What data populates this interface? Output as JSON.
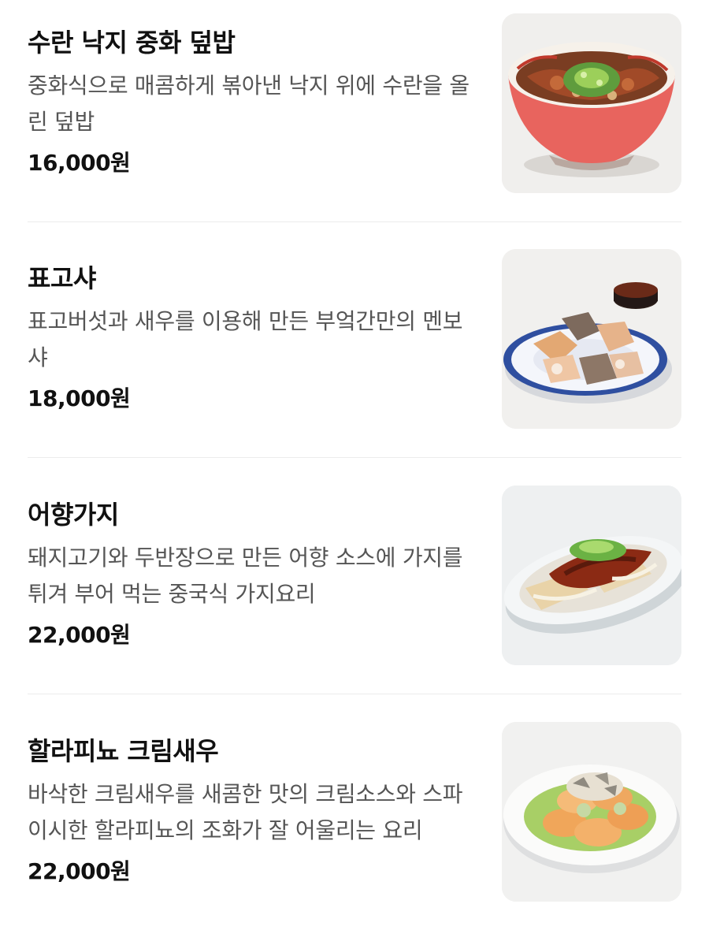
{
  "menu": {
    "items": [
      {
        "name": "수란 낙지 중화 덮밥",
        "description": "중화식으로 매콤하게 볶아낸 낙지 위에 수란을 올린 덮밥",
        "price": "16,000원",
        "photo_icon": "rice-bowl-photo"
      },
      {
        "name": "표고샤",
        "description": "표고버섯과 새우를 이용해 만든 부엌간만의 멘보샤",
        "price": "18,000원",
        "photo_icon": "shrimp-toast-photo"
      },
      {
        "name": "어향가지",
        "description": "돼지고기와 두반장으로 만든 어향 소스에 가지를 튀겨 부어 먹는 중국식 가지요리",
        "price": "22,000원",
        "photo_icon": "eggplant-dish-photo"
      },
      {
        "name": "할라피뇨 크림새우",
        "description": "바삭한 크림새우를 새콤한 맛의 크림소스와 스파이시한 할라피뇨의 조화가 잘 어울리는 요리",
        "price": "22,000원",
        "photo_icon": "cream-shrimp-photo"
      }
    ]
  }
}
